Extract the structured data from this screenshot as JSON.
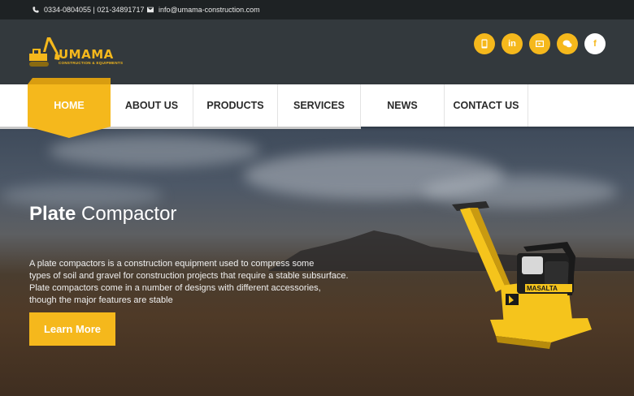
{
  "topbar": {
    "phone": "0334-0804055 | 021-34891717",
    "email": "info@umama-construction.com"
  },
  "logo": {
    "brand": "UMAMA",
    "tagline": "CONSTRUCTION & EQUIPMENTS"
  },
  "socials": [
    {
      "icon": "mobile-icon"
    },
    {
      "icon": "linkedin-icon",
      "label": "in"
    },
    {
      "icon": "video-icon"
    },
    {
      "icon": "chat-icon"
    },
    {
      "icon": "facebook-icon",
      "label": "f"
    }
  ],
  "nav": {
    "items": [
      "HOME",
      "ABOUT US",
      "PRODUCTS",
      "SERVICES",
      "NEWS",
      "CONTACT US"
    ],
    "active": "HOME"
  },
  "hero": {
    "title_bold": "Plate",
    "title_light": "Compactor",
    "lines": [
      "A plate compactors is a construction equipment used to compress some",
      "types of soil and gravel for construction projects that require a stable subsurface.",
      "Plate compactors come in a number of designs with different accessories,",
      "though the major features are stable"
    ],
    "button": "Learn More",
    "machine_brand": "MASALTA"
  },
  "colors": {
    "accent": "#f5b81c",
    "header": "#33393d",
    "topbar": "#1e2224"
  }
}
